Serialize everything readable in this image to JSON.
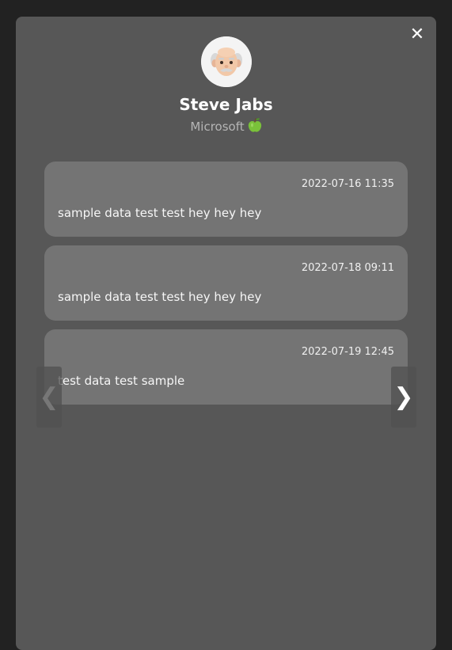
{
  "close_icon": "close-icon",
  "profile": {
    "avatar_icon": "old-man-emoji-icon",
    "name": "Steve Jabs",
    "company": "Microsoft",
    "company_emoji_icon": "green-apple-icon"
  },
  "messages": [
    {
      "time": "2022-07-16 11:35",
      "text": "sample data test test hey hey hey"
    },
    {
      "time": "2022-07-18 09:11",
      "text": "sample data test test hey hey hey"
    },
    {
      "time": "2022-07-19 12:45",
      "text": "test data test sample"
    }
  ],
  "nav": {
    "prev_glyph": "❮",
    "next_glyph": "❯"
  },
  "colors": {
    "page_background": "#222222",
    "modal_background": "#575757",
    "message_background": "#747474",
    "company_text": "#b5b5b5",
    "apple_green": "#7ac13a"
  }
}
